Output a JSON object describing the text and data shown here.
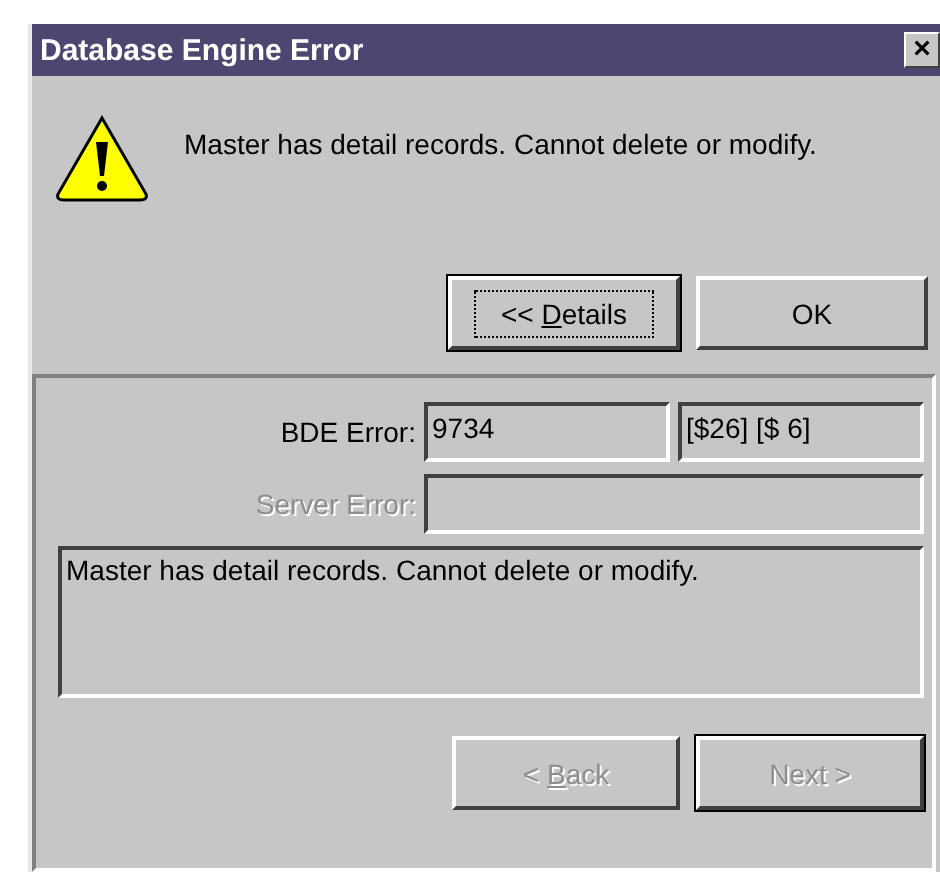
{
  "window": {
    "title": "Database Engine Error",
    "close": "×"
  },
  "message": "Master has detail records. Cannot delete or modify.",
  "buttons": [
    {
      "before": "<< ",
      "access_key": "D",
      "after": "etails",
      "disabled": false,
      "focused": true,
      "default": true
    },
    {
      "before": "OK",
      "disabled": false,
      "focused": false,
      "default": false
    }
  ],
  "details": {
    "rows": [
      {
        "label": "BDE Error:",
        "disabled": false,
        "fields": [
          "9734",
          "[$26] [$ 6]"
        ]
      },
      {
        "label": "Server Error:",
        "disabled": true,
        "empty_field": true
      }
    ],
    "memo": "Master has detail records. Cannot delete or modify.",
    "buttons": [
      {
        "before": "< ",
        "access_key": "B",
        "after": "ack",
        "disabled": true,
        "focused": false,
        "default": false
      },
      {
        "before": "Next >",
        "disabled": true,
        "focused": false,
        "default": true
      }
    ]
  }
}
